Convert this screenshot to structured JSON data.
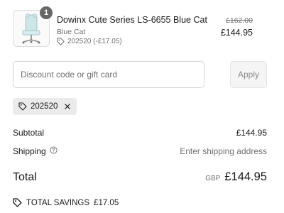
{
  "product": {
    "quantity": "1",
    "title": "Dowinx Cute Series LS-6655 Blue Cat",
    "variant": "Blue Cat",
    "discount_line": "202520 (-£17.05)",
    "price_original": "£162.00",
    "price_current": "£144.95",
    "thumbnail": "office-chair-image"
  },
  "discount": {
    "placeholder": "Discount code or gift card",
    "apply_label": "Apply",
    "applied_code": "202520"
  },
  "summary": {
    "subtotal_label": "Subtotal",
    "subtotal_value": "£144.95",
    "shipping_label": "Shipping",
    "shipping_value": "Enter shipping address",
    "total_label": "Total",
    "currency": "GBP",
    "total_value": "£144.95",
    "savings_label": "TOTAL SAVINGS",
    "savings_value": "£17.05"
  },
  "icons": {
    "tag": "tag-icon",
    "close": "close-icon",
    "help": "help-icon",
    "savings": "discount-tag-icon"
  },
  "colors": {
    "text": "#1a1a1a",
    "muted": "#707070",
    "chip_bg": "#ebebeb",
    "badge": "#666666"
  }
}
